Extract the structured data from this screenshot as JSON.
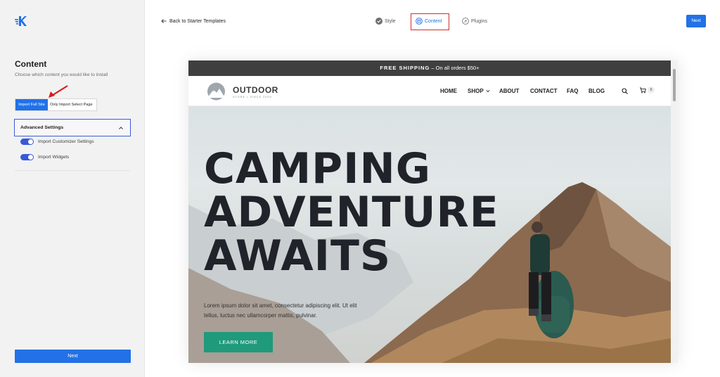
{
  "sidebar": {
    "title": "Content",
    "description": "Choose which content you would like to install",
    "import_options": [
      "Import Full Site",
      "Only Import Select Page"
    ],
    "advanced_settings_label": "Advanced Settings",
    "toggles": [
      {
        "label": "Import Customizer Settings",
        "on": true
      },
      {
        "label": "Import Widgets",
        "on": true
      }
    ],
    "next_label": "Next"
  },
  "topbar": {
    "back_label": "Back to Starter Templates",
    "steps": [
      {
        "label": "Style",
        "icon": "check-circle-icon"
      },
      {
        "label": "Content",
        "icon": "content-icon",
        "active": true
      },
      {
        "label": "Plugins",
        "icon": "plug-icon"
      }
    ],
    "next_label": "Next"
  },
  "preview": {
    "shipping_bold": "FREE SHIPPING",
    "shipping_rest": " – On all orders $50+",
    "brand_name": "OUTDOOR",
    "brand_tagline": "STORE • SINCE 2009",
    "menu": [
      "HOME",
      "SHOP",
      "ABOUT",
      "CONTACT",
      "FAQ",
      "BLOG"
    ],
    "cart_count": "0",
    "hero_line1": "CAMPING",
    "hero_line2": "ADVENTURE",
    "hero_line3": "AWAITS",
    "hero_text": "Lorem ipsum dolor sit amet, consectetur adipiscing elit. Ut elit tellus, luctus nec ullamcorper mattis, pulvinar.",
    "hero_button": "LEARN MORE"
  },
  "colors": {
    "primary": "#2271e6",
    "toggle": "#3858d6",
    "highlight_box": "#d12f2f",
    "learn_more": "#1f9a7b",
    "shipping_bar": "#3f3f3f"
  }
}
